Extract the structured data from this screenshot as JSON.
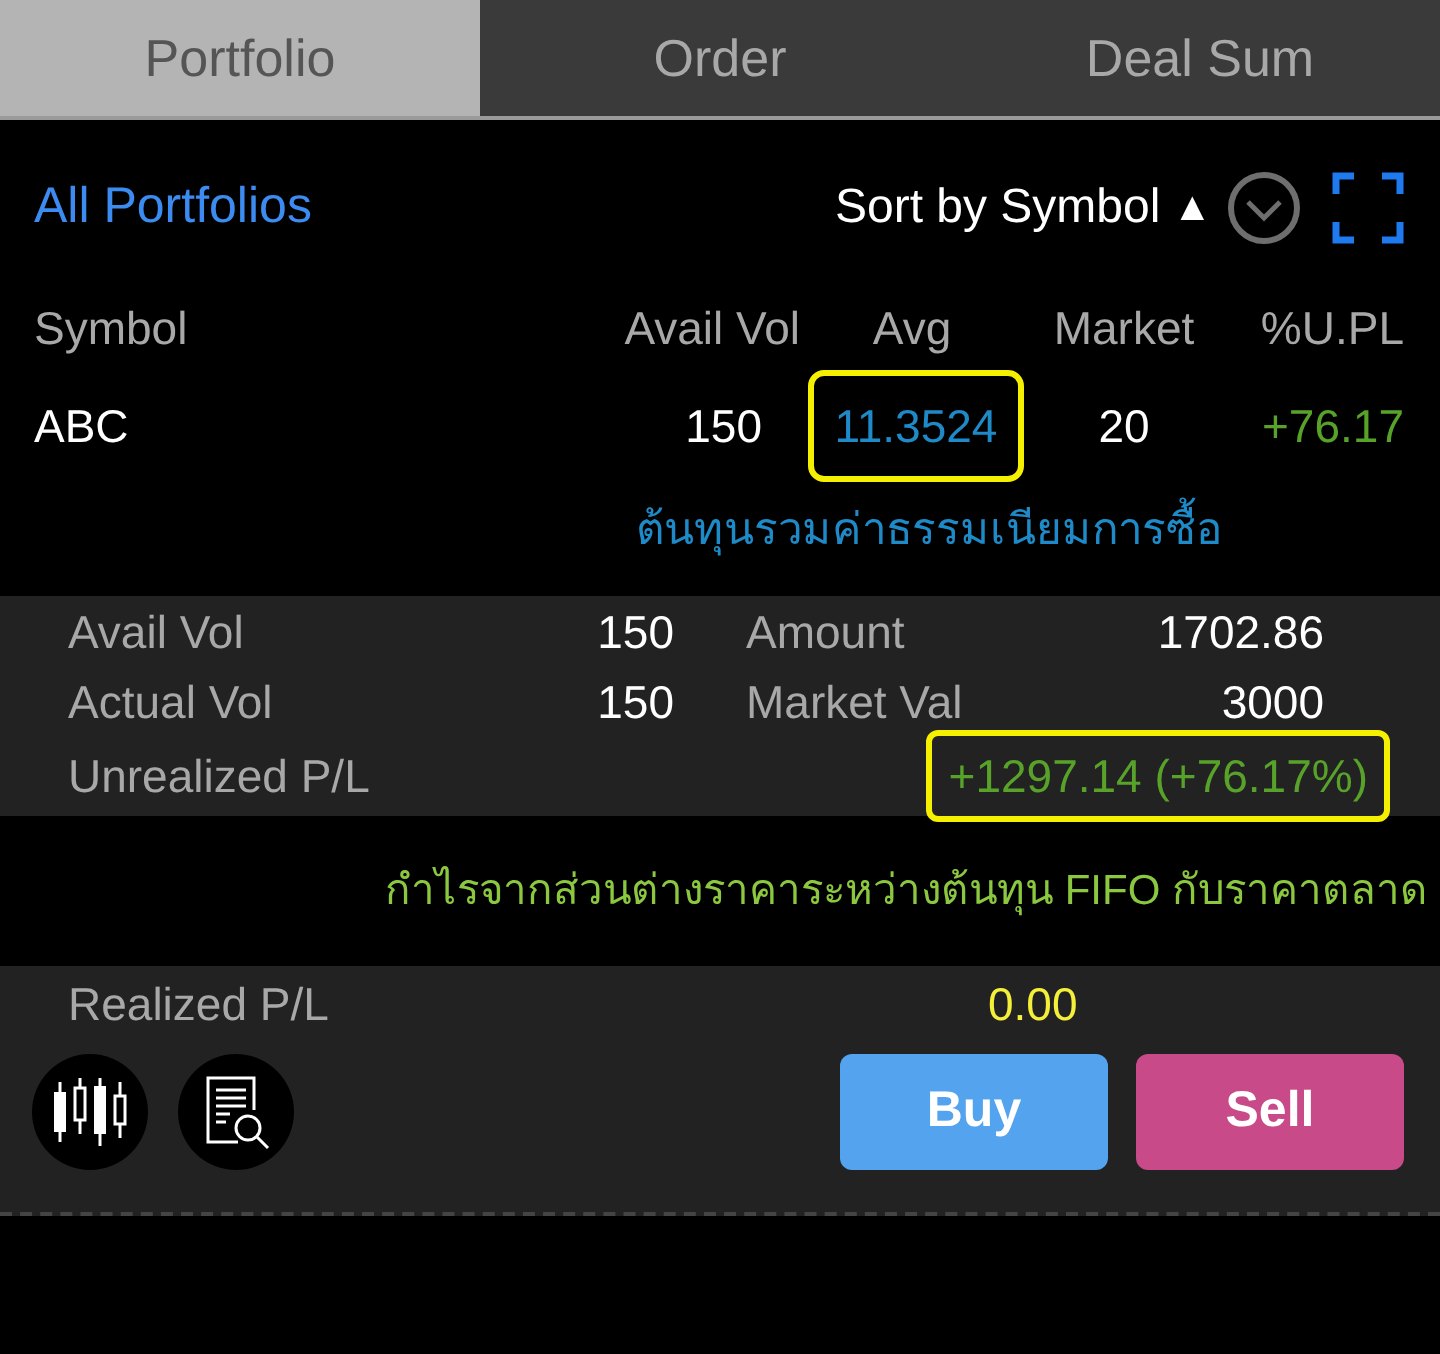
{
  "tabs": [
    {
      "label": "Portfolio",
      "selected": true
    },
    {
      "label": "Order",
      "selected": false
    },
    {
      "label": "Deal Sum",
      "selected": false
    }
  ],
  "header": {
    "portfolio_selector": "All Portfolios",
    "sort_label": "Sort by Symbol",
    "sort_arrow": "▲"
  },
  "table": {
    "columns": [
      "Symbol",
      "Avail Vol",
      "Avg",
      "Market",
      "%U.PL"
    ],
    "rows": [
      {
        "symbol": "ABC",
        "avail_vol": "150",
        "avg": "11.3524",
        "avg_highlighted": true,
        "market": "20",
        "upl_pct": "+76.17"
      }
    ]
  },
  "avg_note": "ต้นทุนรวมค่าธรรมเนียมการซื้อ",
  "summary": {
    "fields": [
      {
        "label": "Avail Vol",
        "value": "150"
      },
      {
        "label": "Amount",
        "value": "1702.86"
      },
      {
        "label": "Actual Vol",
        "value": "150"
      },
      {
        "label": "Market Val",
        "value": "3000"
      }
    ],
    "unrealized": {
      "label": "Unrealized P/L",
      "value": "+1297.14 (+76.17%)",
      "highlighted": true
    }
  },
  "unrealized_note": "กำไรจากส่วนต่างราคาระหว่างต้นทุน FIFO กับราคาตลาด",
  "realized": {
    "label": "Realized P/L",
    "value": "0.00"
  },
  "actions": [
    {
      "kind": "buy",
      "label": "Buy"
    },
    {
      "kind": "sell",
      "label": "Sell"
    }
  ]
}
